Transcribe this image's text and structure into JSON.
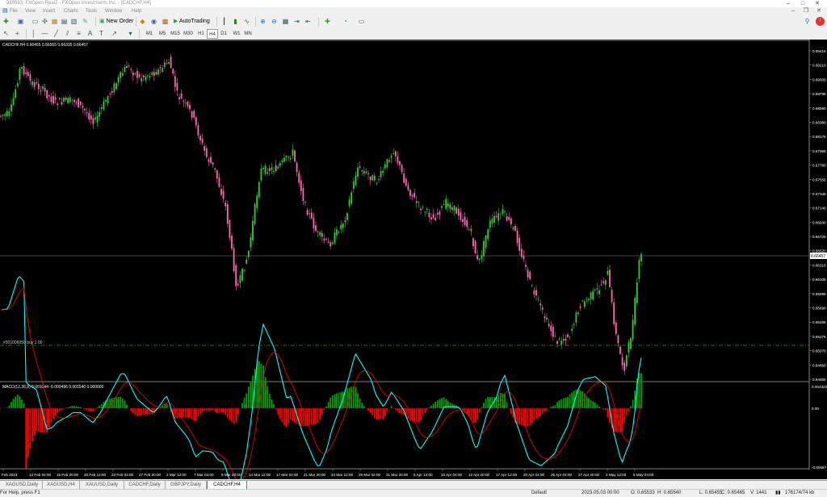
{
  "window": {
    "title": "989593: FXOpen-Real2 - FXOpen Investments Inc. - [CADCHF,H4]"
  },
  "menu": [
    "File",
    "View",
    "Insert",
    "Charts",
    "Tools",
    "Window",
    "Help"
  ],
  "toolbar": {
    "new_order_label": "New Order",
    "autotrading_label": "AutoTrading"
  },
  "timeframes": [
    "M1",
    "M5",
    "M15",
    "M30",
    "H1",
    "H4",
    "D1",
    "W1",
    "MN"
  ],
  "active_timeframe": "H4",
  "chart": {
    "header": "CADCHF,H4  0.66465 0.66565 0.66335 0.66457",
    "current_price_label": "0.66457",
    "order_label": "#301006050 buy 1.00",
    "price_ticks": [
      "0.69415",
      "0.69210",
      "0.69000",
      "0.68795",
      "0.68590",
      "0.68380",
      "0.68175",
      "0.67965",
      "0.67760",
      "0.67555",
      "0.67345",
      "0.67140",
      "0.66930",
      "0.66725",
      "0.66520",
      "0.66310",
      "0.66105",
      "0.65895",
      "0.65690",
      "0.65485",
      "0.65275",
      "0.65070",
      "0.64860",
      "0.64655"
    ],
    "candle_up_color": "#32cd32",
    "candle_down_color": "#ff69b4",
    "grid_line_color": "#808080"
  },
  "macd": {
    "header": "MACD(12,26,9) 0.001044 -0.000496 0.001540 0.000000",
    "ticks": [
      "0.002322",
      "0.00",
      "-0.00587"
    ],
    "hist_up_color": "#00a000",
    "hist_down_color": "#ff0000",
    "macd_line_color": "#00ffff",
    "signal_line_color": "#ff0000"
  },
  "time_axis": [
    "Feb 2023",
    "13 Feb 04:00",
    "15 Feb 20:00",
    "20 Feb 12:00",
    "23 Feb 04:00",
    "27 Feb 20:00",
    "2 Mar 12:00",
    "7 Mar 04:00",
    "9 Mar 20:00",
    "14 Mar 12:00",
    "17 Mar 04:00",
    "21 Mar 20:00",
    "24 Mar 12:00",
    "29 Mar 04:00",
    "31 Mar 20:00",
    "5 Apr 12:00",
    "10 Apr 04:00",
    "12 Apr 20:00",
    "17 Apr 12:00",
    "20 Apr 04:00",
    "25 Apr 04:00",
    "27 Apr 20:00",
    "2 May 12:00",
    "5 May 04:00"
  ],
  "tabs": [
    "XAGUSD,Daily",
    "XAGUSD,H4",
    "XAUUSD,Daily",
    "CADCHF,Daily",
    "GBPJPY,Daily",
    "CADCHF,H4"
  ],
  "active_tab": "CADCHF,H4",
  "status": {
    "help": "For Help, press F1",
    "profile": "Default",
    "datetime": "2023.05.03 00:00",
    "open": "O: 0.65533",
    "high": "H: 0.65540",
    "low": "L: 0.65455",
    "close": "C: 0.65465",
    "volume": "V: 1441",
    "traffic": "176174/74 kb"
  }
}
